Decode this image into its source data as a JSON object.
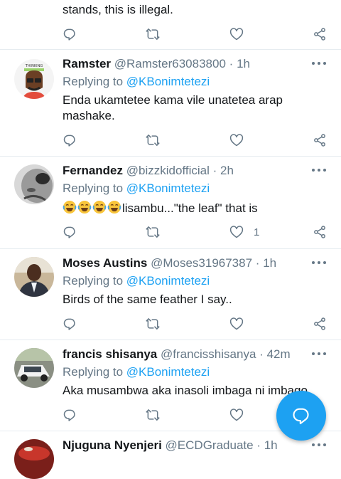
{
  "top_partial_tweet": {
    "text": "stands, this is illegal."
  },
  "tweets": [
    {
      "name": "Ramster",
      "handle": "@Ramster63083800",
      "time": "1h",
      "replying_label": "Replying to",
      "replying_to": "@KBonimtetezi",
      "text": "Enda ukamtetee kama vile unatetea arap mashake.",
      "like_count": "",
      "avatar": "thinking-cartoon-avatar"
    },
    {
      "name": "Fernandez",
      "handle": "@bizzkidofficial",
      "time": "2h",
      "replying_label": "Replying to",
      "replying_to": "@KBonimtetezi",
      "emoji": "😂😂😂😂",
      "text": "lisambu...\"the leaf\" that is",
      "like_count": "1",
      "avatar": "grayscale-face-avatar"
    },
    {
      "name": "Moses Austins",
      "handle": "@Moses31967387",
      "time": "1h",
      "replying_label": "Replying to",
      "replying_to": "@KBonimtetezi",
      "text": "Birds of the same feather I say..",
      "like_count": "",
      "avatar": "man-in-suit-avatar"
    },
    {
      "name": "francis shisanya",
      "handle": "@francisshisanya",
      "time": "42m",
      "replying_label": "Replying to",
      "replying_to": "@KBonimtetezi",
      "text": "Aka musambwa aka inasoli imbaga ni imbago",
      "like_count": "",
      "avatar": "white-car-avatar"
    },
    {
      "name": "Njuguna Nyenjeri",
      "handle": "@ECDGraduate",
      "time": "1h",
      "avatar": "red-photo-avatar"
    }
  ],
  "colors": {
    "accent": "#1da1f2",
    "muted": "#657786",
    "divider": "#e6ecf0"
  },
  "icons": [
    "reply-icon",
    "retweet-icon",
    "like-icon",
    "share-icon",
    "more-icon",
    "compose-reply-icon"
  ]
}
